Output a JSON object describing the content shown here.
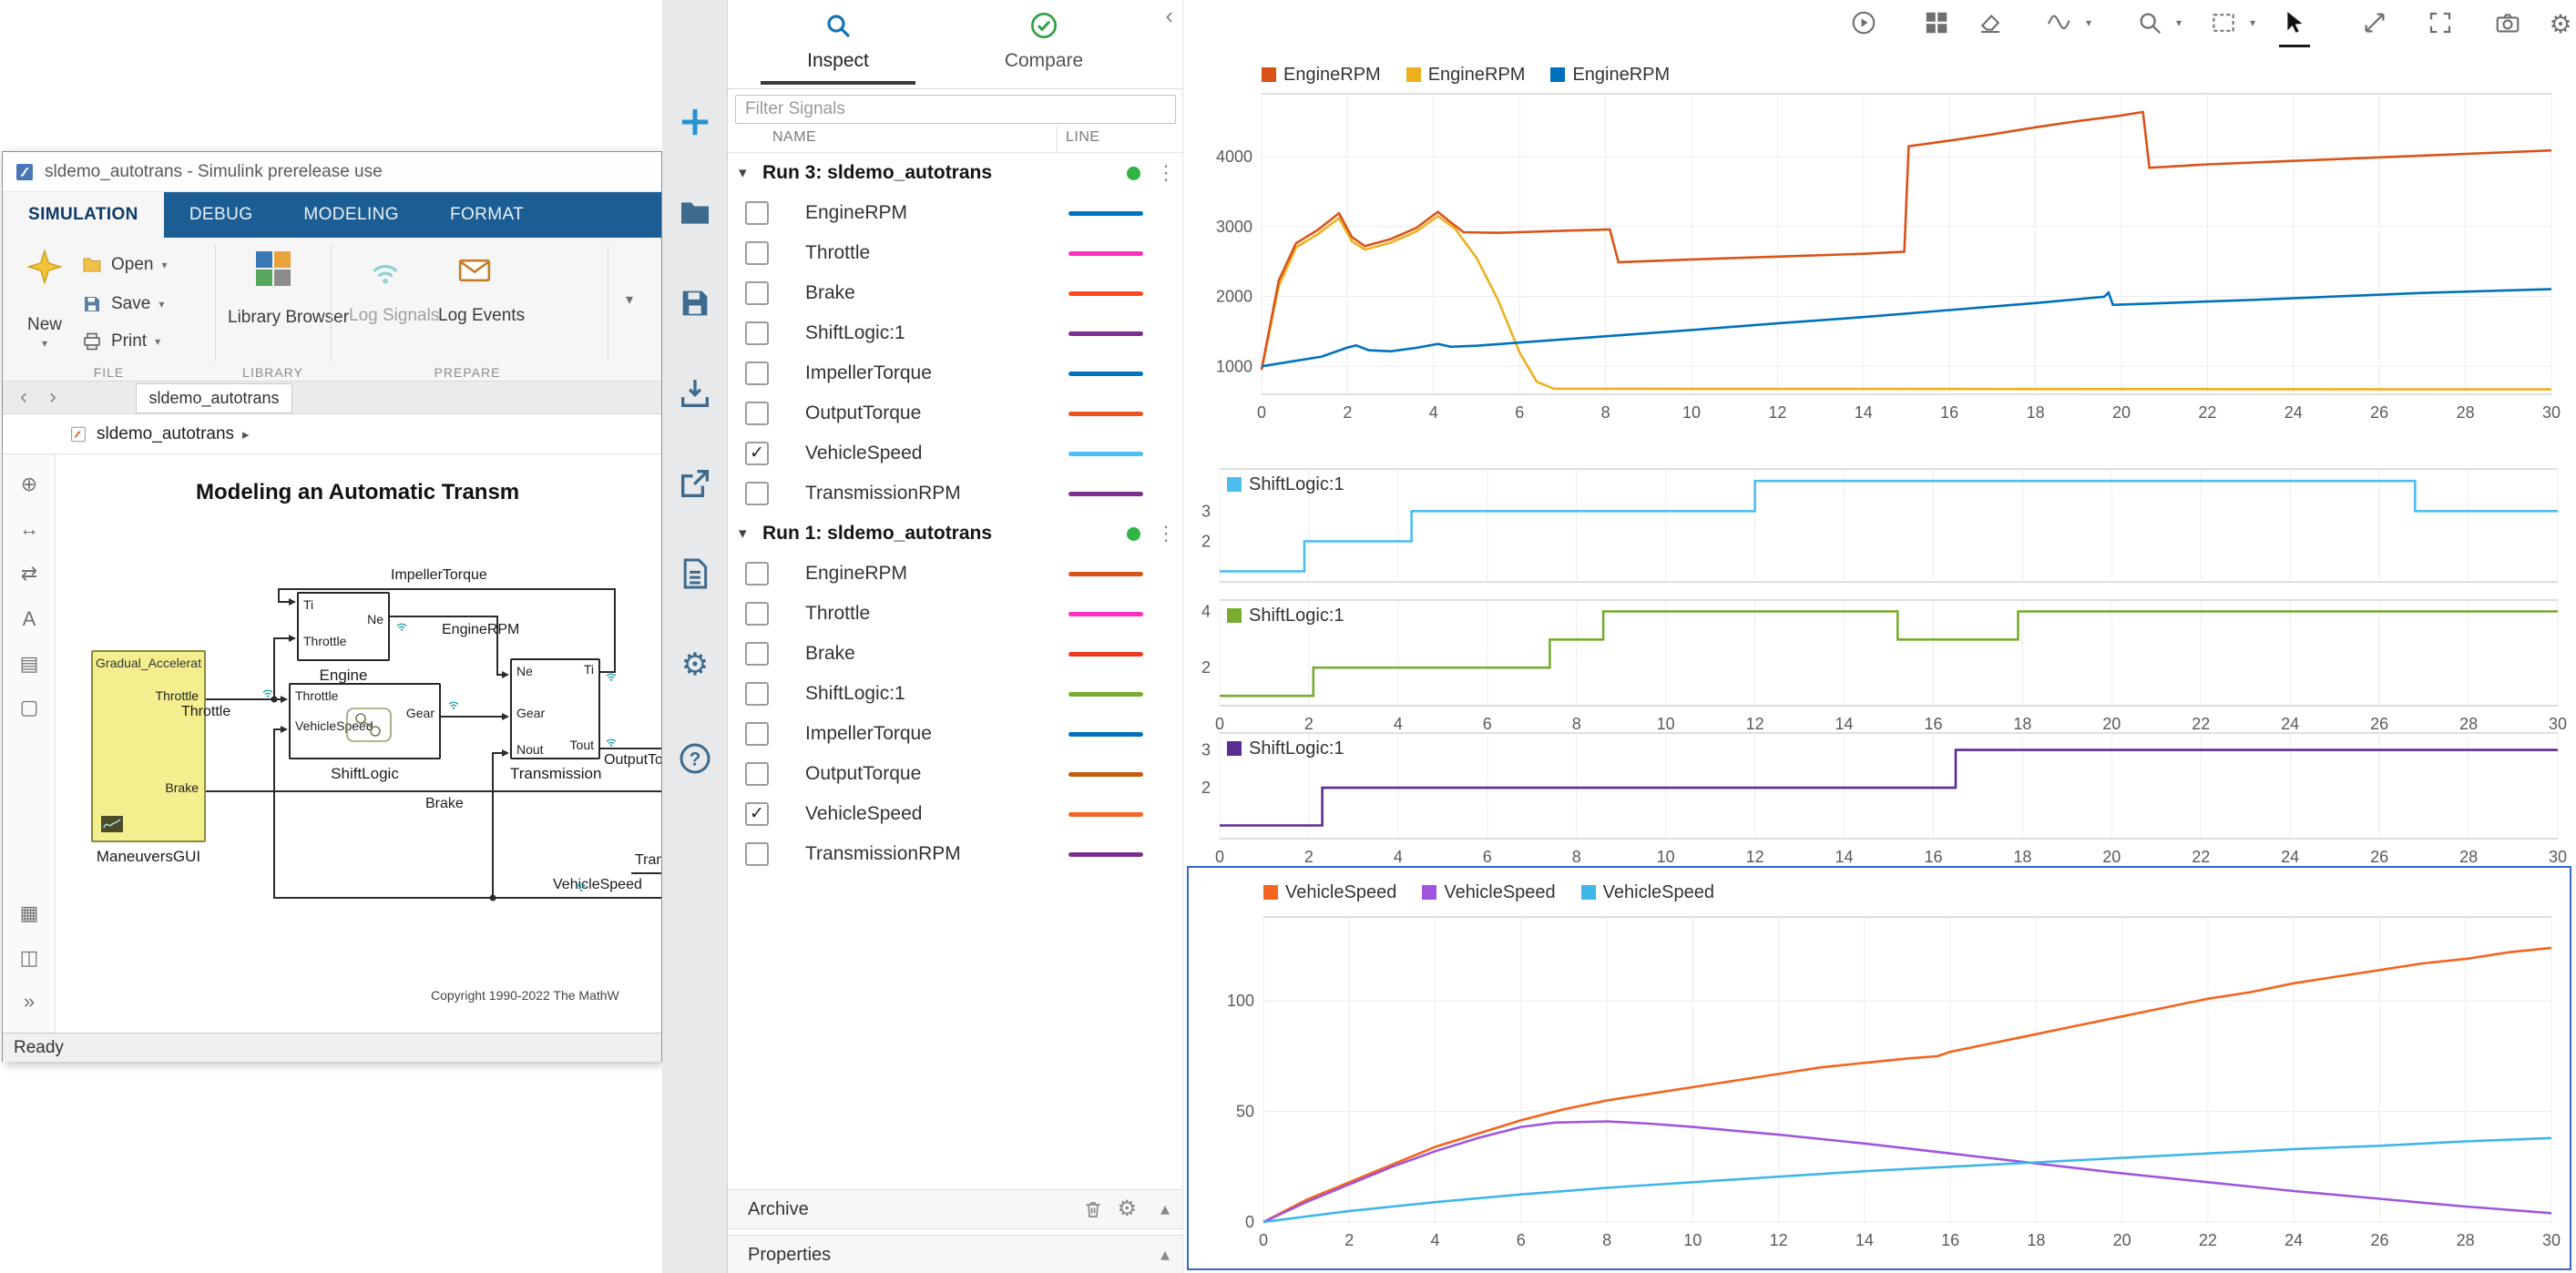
{
  "glyphs": {
    "caret_down": "▾",
    "caret_up": "▴",
    "breadcrumb_arrow": "▸",
    "back": "‹",
    "forward": "›",
    "menu": "⋮",
    "check": "✓",
    "gear": "⚙",
    "more": "»"
  },
  "colors": {
    "ribbon_blue": "#1c5d94",
    "selection_blue": "#3566cd",
    "run_dot_green": "#2eb344",
    "accent_blue": "#0072bd"
  },
  "simulink_window": {
    "title": "sldemo_autotrans - Simulink prerelease use",
    "ribbon_tabs": [
      {
        "label": "SIMULATION",
        "active": true
      },
      {
        "label": "DEBUG",
        "active": false
      },
      {
        "label": "MODELING",
        "active": false
      },
      {
        "label": "FORMAT",
        "active": false
      }
    ],
    "toolbar": {
      "new_label": "New",
      "open_label": "Open",
      "save_label": "Save",
      "print_label": "Print",
      "file_caption": "FILE",
      "library_browser_label": "Library Browser",
      "library_caption": "LIBRARY",
      "log_signals_label": "Log Signals",
      "log_events_label": "Log Events",
      "prepare_caption": "PREPARE"
    },
    "doc_tab": "sldemo_autotrans",
    "breadcrumb": "sldemo_autotrans",
    "canvas": {
      "title": "Modeling an Automatic Transm",
      "copyright": "Copyright 1990-2022 The MathW",
      "labels": {
        "impeller": "ImpellerTorque",
        "engine_rpm": "EngineRPM",
        "throttle": "Throttle",
        "brake": "Brake",
        "output_torque": "OutputTor",
        "vehicle_speed": "VehicleSpeed",
        "transmission": "Tran"
      },
      "blocks": {
        "maneuvers": {
          "header": "Gradual_Accelerat",
          "port1": "Throttle",
          "port2": "Brake",
          "label": "ManeuversGUI"
        },
        "engine": {
          "in1": "Ti",
          "in2": "Throttle",
          "out1": "Ne",
          "label": "Engine"
        },
        "shiftlogic": {
          "in1": "Throttle",
          "in2": "VehicleSpeed",
          "out1": "Gear",
          "label": "ShiftLogic"
        },
        "transmission": {
          "in1": "Ne",
          "in2": "Gear",
          "in3": "Nout",
          "out1": "Ti",
          "out2": "Tout",
          "label": "Transmission"
        }
      },
      "palette_glyphs": [
        "⊕",
        "↔",
        "⇄",
        "A",
        "▤",
        "▢",
        "▦",
        "◫",
        "»"
      ]
    },
    "status": "Ready"
  },
  "left_toolbar": {
    "icons": [
      "add",
      "open",
      "save",
      "import",
      "export",
      "report",
      "settings",
      "help"
    ]
  },
  "inspector": {
    "tabs": [
      {
        "label": "Inspect",
        "active": true
      },
      {
        "label": "Compare",
        "active": false
      }
    ],
    "filter_placeholder": "Filter Signals",
    "columns": {
      "name": "NAME",
      "line": "LINE"
    },
    "runs": [
      {
        "title": "Run 3: sldemo_autotrans",
        "signals": [
          {
            "name": "EngineRPM",
            "color": "#0072bd",
            "checked": false
          },
          {
            "name": "Throttle",
            "color": "#ff2fbe",
            "checked": false
          },
          {
            "name": "Brake",
            "color": "#fe4a1c",
            "checked": false
          },
          {
            "name": "ShiftLogic:1",
            "color": "#7e2f8e",
            "checked": false
          },
          {
            "name": "ImpellerTorque",
            "color": "#0072bd",
            "checked": false
          },
          {
            "name": "OutputTorque",
            "color": "#e8541e",
            "checked": false
          },
          {
            "name": "VehicleSpeed",
            "color": "#4dbeee",
            "checked": true
          },
          {
            "name": "TransmissionRPM",
            "color": "#7e2f8e",
            "checked": false
          }
        ]
      },
      {
        "title": "Run 1: sldemo_autotrans",
        "signals": [
          {
            "name": "EngineRPM",
            "color": "#d95319",
            "checked": false
          },
          {
            "name": "Throttle",
            "color": "#ff2fbe",
            "checked": false
          },
          {
            "name": "Brake",
            "color": "#ef3a21",
            "checked": false
          },
          {
            "name": "ShiftLogic:1",
            "color": "#77ac30",
            "checked": false
          },
          {
            "name": "ImpellerTorque",
            "color": "#0072bd",
            "checked": false
          },
          {
            "name": "OutputTorque",
            "color": "#c85a0e",
            "checked": false
          },
          {
            "name": "VehicleSpeed",
            "color": "#f4641e",
            "checked": true
          },
          {
            "name": "TransmissionRPM",
            "color": "#7e2f8e",
            "checked": false
          }
        ]
      }
    ],
    "archive_label": "Archive",
    "properties_label": "Properties"
  },
  "plot_toolbar": {
    "icons": [
      {
        "name": "run"
      },
      {
        "name": "layout-grid"
      },
      {
        "name": "eraser"
      },
      {
        "name": "line-style",
        "dropdown": true
      },
      {
        "name": "zoom",
        "dropdown": true
      },
      {
        "name": "fit-view",
        "dropdown": true
      },
      {
        "name": "pointer",
        "active": true
      },
      {
        "name": "expand"
      },
      {
        "name": "fullscreen"
      },
      {
        "name": "snapshot"
      },
      {
        "name": "settings"
      }
    ]
  },
  "chart_data": [
    {
      "type": "line",
      "id": "engine-rpm-plot",
      "legend": [
        {
          "label": "EngineRPM",
          "color": "#d95319"
        },
        {
          "label": "EngineRPM",
          "color": "#edb120"
        },
        {
          "label": "EngineRPM",
          "color": "#0072bd"
        }
      ],
      "x_range": [
        0,
        30
      ],
      "y_range": [
        600,
        4900
      ],
      "x_ticks": [
        0,
        2,
        4,
        6,
        8,
        10,
        12,
        14,
        16,
        18,
        20,
        22,
        24,
        26,
        28,
        30
      ],
      "y_ticks": [
        1000,
        2000,
        3000,
        4000
      ],
      "show_x_labels": true,
      "series": [
        {
          "name": "EngineRPM (yellow run)",
          "color": "#edb120",
          "points": [
            [
              0,
              950
            ],
            [
              0.4,
              2150
            ],
            [
              0.8,
              2700
            ],
            [
              1.3,
              2890
            ],
            [
              1.8,
              3120
            ],
            [
              2.1,
              2790
            ],
            [
              2.4,
              2670
            ],
            [
              3,
              2770
            ],
            [
              3.6,
              2930
            ],
            [
              4.1,
              3150
            ],
            [
              4.5,
              2970
            ],
            [
              5,
              2550
            ],
            [
              5.5,
              1950
            ],
            [
              6,
              1200
            ],
            [
              6.4,
              780
            ],
            [
              6.8,
              680
            ],
            [
              30,
              670
            ]
          ]
        },
        {
          "name": "EngineRPM (run 1)",
          "color": "#d95319",
          "points": [
            [
              0,
              950
            ],
            [
              0.4,
              2230
            ],
            [
              0.8,
              2760
            ],
            [
              1.3,
              2950
            ],
            [
              1.8,
              3190
            ],
            [
              2.1,
              2850
            ],
            [
              2.4,
              2720
            ],
            [
              3,
              2820
            ],
            [
              3.6,
              2980
            ],
            [
              4.1,
              3210
            ],
            [
              4.4,
              3060
            ],
            [
              4.7,
              2920
            ],
            [
              5.5,
              2910
            ],
            [
              7,
              2940
            ],
            [
              8.1,
              2960
            ],
            [
              8.3,
              2490
            ],
            [
              10,
              2530
            ],
            [
              12,
              2570
            ],
            [
              14,
              2610
            ],
            [
              14.95,
              2640
            ],
            [
              15.05,
              4150
            ],
            [
              16,
              4230
            ],
            [
              17,
              4320
            ],
            [
              18,
              4420
            ],
            [
              19,
              4510
            ],
            [
              20,
              4590
            ],
            [
              20.5,
              4640
            ],
            [
              20.65,
              3840
            ],
            [
              22,
              3890
            ],
            [
              24,
              3940
            ],
            [
              26,
              3990
            ],
            [
              28,
              4040
            ],
            [
              30,
              4090
            ]
          ]
        },
        {
          "name": "EngineRPM (run 3)",
          "color": "#0072bd",
          "points": [
            [
              0,
              1000
            ],
            [
              0.8,
              1080
            ],
            [
              1.4,
              1140
            ],
            [
              2,
              1270
            ],
            [
              2.2,
              1300
            ],
            [
              2.5,
              1230
            ],
            [
              3,
              1215
            ],
            [
              3.6,
              1265
            ],
            [
              4.1,
              1320
            ],
            [
              4.4,
              1280
            ],
            [
              5,
              1295
            ],
            [
              6,
              1340
            ],
            [
              8,
              1430
            ],
            [
              10,
              1520
            ],
            [
              12,
              1615
            ],
            [
              14,
              1705
            ],
            [
              16,
              1805
            ],
            [
              18,
              1905
            ],
            [
              19.6,
              1995
            ],
            [
              19.7,
              2055
            ],
            [
              19.8,
              1880
            ],
            [
              21,
              1905
            ],
            [
              23,
              1950
            ],
            [
              25,
              2000
            ],
            [
              27,
              2050
            ],
            [
              30,
              2105
            ]
          ]
        }
      ]
    },
    {
      "type": "step",
      "id": "shiftlogic-strip-1",
      "name": "ShiftLogic:1",
      "color": "#4dbeee",
      "x_range": [
        0,
        30
      ],
      "y_range": [
        0.65,
        4.4
      ],
      "x_ticks": [
        0,
        2,
        4,
        6,
        8,
        10,
        12,
        14,
        16,
        18,
        20,
        22,
        24,
        26,
        28,
        30
      ],
      "y_ticks": [
        3,
        2
      ],
      "show_x_labels": false,
      "steps": [
        [
          0,
          1
        ],
        [
          1.9,
          2
        ],
        [
          4.3,
          3
        ],
        [
          12,
          4
        ],
        [
          26.8,
          3
        ]
      ]
    },
    {
      "type": "step",
      "id": "shiftlogic-strip-2",
      "name": "ShiftLogic:1",
      "color": "#77ac30",
      "x_range": [
        0,
        30
      ],
      "y_range": [
        0.65,
        4.4
      ],
      "x_ticks": [
        0,
        2,
        4,
        6,
        8,
        10,
        12,
        14,
        16,
        18,
        20,
        22,
        24,
        26,
        28,
        30
      ],
      "y_ticks": [
        4,
        2
      ],
      "show_x_labels": true,
      "steps": [
        [
          0,
          1
        ],
        [
          2.1,
          2
        ],
        [
          7.4,
          3
        ],
        [
          8.6,
          4
        ],
        [
          15.2,
          3
        ],
        [
          17.9,
          4
        ]
      ]
    },
    {
      "type": "step",
      "id": "shiftlogic-strip-3",
      "name": "ShiftLogic:1",
      "color": "#5b2c91",
      "x_range": [
        0,
        30
      ],
      "y_range": [
        0.65,
        3.45
      ],
      "x_ticks": [
        0,
        2,
        4,
        6,
        8,
        10,
        12,
        14,
        16,
        18,
        20,
        22,
        24,
        26,
        28,
        30
      ],
      "y_ticks": [
        3,
        2
      ],
      "show_x_labels": true,
      "steps": [
        [
          0,
          1
        ],
        [
          2.3,
          2
        ],
        [
          16.5,
          3
        ]
      ]
    },
    {
      "type": "line",
      "id": "vehicle-speed-plot",
      "selected": true,
      "legend": [
        {
          "label": "VehicleSpeed",
          "color": "#f4641e"
        },
        {
          "label": "VehicleSpeed",
          "color": "#a055e0"
        },
        {
          "label": "VehicleSpeed",
          "color": "#3fb6ea"
        }
      ],
      "x_range": [
        0,
        30
      ],
      "y_range": [
        0,
        138
      ],
      "x_ticks": [
        0,
        2,
        4,
        6,
        8,
        10,
        12,
        14,
        16,
        18,
        20,
        22,
        24,
        26,
        28,
        30
      ],
      "y_ticks": [
        0,
        50,
        100
      ],
      "show_x_labels": true,
      "series": [
        {
          "name": "VehicleSpeed (run 1)",
          "color": "#f4641e",
          "points": [
            [
              0,
              0
            ],
            [
              1,
              10
            ],
            [
              2,
              18
            ],
            [
              3,
              26
            ],
            [
              4,
              34
            ],
            [
              5,
              40
            ],
            [
              6,
              46
            ],
            [
              7,
              51
            ],
            [
              8,
              55
            ],
            [
              9,
              58
            ],
            [
              10,
              61
            ],
            [
              11,
              64
            ],
            [
              12,
              67
            ],
            [
              13,
              70
            ],
            [
              14,
              72
            ],
            [
              15,
              74
            ],
            [
              15.7,
              75
            ],
            [
              16,
              77
            ],
            [
              17,
              81
            ],
            [
              18,
              85
            ],
            [
              19,
              89
            ],
            [
              20,
              93
            ],
            [
              21,
              97
            ],
            [
              22,
              101
            ],
            [
              23,
              104
            ],
            [
              24,
              108
            ],
            [
              25,
              111
            ],
            [
              26,
              114
            ],
            [
              27,
              117
            ],
            [
              28,
              119
            ],
            [
              29,
              122
            ],
            [
              30,
              124
            ]
          ]
        },
        {
          "name": "VehicleSpeed (purple run)",
          "color": "#a055e0",
          "points": [
            [
              0,
              0
            ],
            [
              1,
              9
            ],
            [
              2,
              17
            ],
            [
              3,
              25
            ],
            [
              4,
              32
            ],
            [
              5,
              38
            ],
            [
              6,
              43
            ],
            [
              6.8,
              45
            ],
            [
              8,
              45.5
            ],
            [
              9,
              44.5
            ],
            [
              10,
              43
            ],
            [
              12,
              39.5
            ],
            [
              14,
              35.5
            ],
            [
              16,
              31
            ],
            [
              18,
              26.5
            ],
            [
              20,
              22
            ],
            [
              22,
              18
            ],
            [
              24,
              14
            ],
            [
              26,
              10.5
            ],
            [
              28,
              7
            ],
            [
              30,
              4
            ]
          ]
        },
        {
          "name": "VehicleSpeed (run 3)",
          "color": "#3fb6ea",
          "points": [
            [
              0,
              0
            ],
            [
              2,
              5
            ],
            [
              4,
              9
            ],
            [
              6,
              12.5
            ],
            [
              8,
              15.5
            ],
            [
              10,
              18
            ],
            [
              12,
              20.5
            ],
            [
              14,
              23
            ],
            [
              16,
              25
            ],
            [
              18,
              27
            ],
            [
              20,
              29
            ],
            [
              22,
              31
            ],
            [
              24,
              33
            ],
            [
              26,
              34.5
            ],
            [
              28,
              36.5
            ],
            [
              30,
              38
            ]
          ]
        }
      ]
    }
  ]
}
